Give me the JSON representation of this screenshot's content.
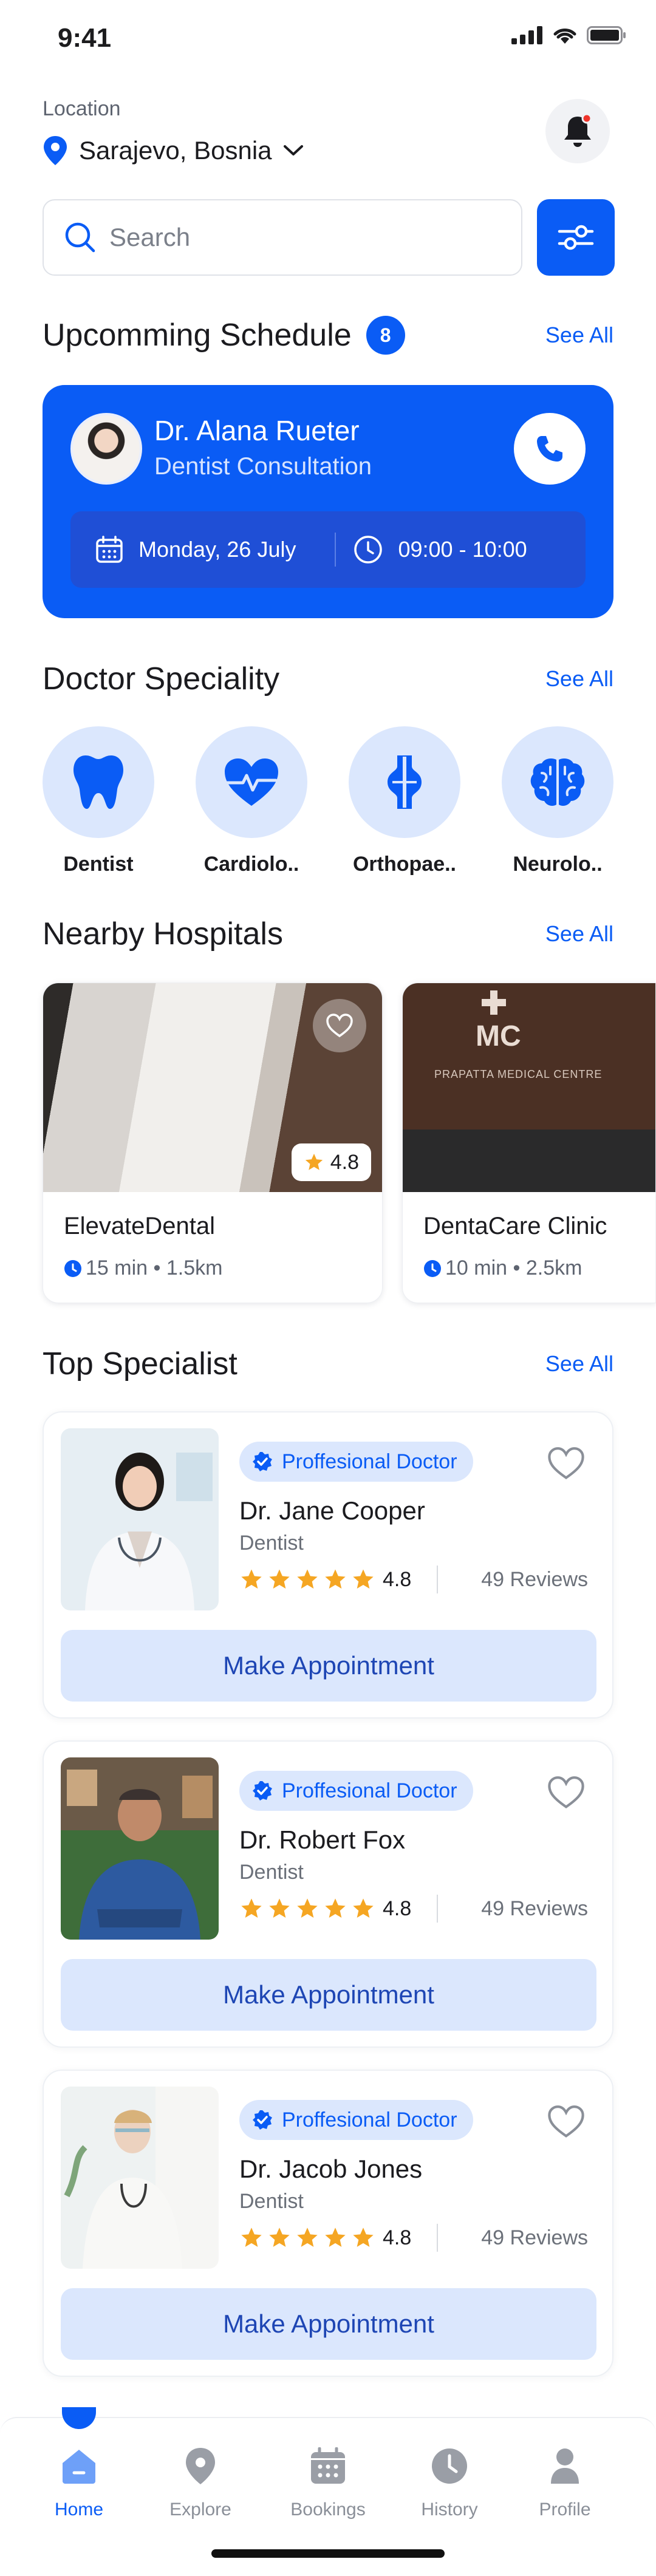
{
  "status_bar": {
    "time": "9:41"
  },
  "header": {
    "location_label": "Location",
    "location_value": "Sarajevo, Bosnia"
  },
  "search": {
    "placeholder": "Search"
  },
  "schedule": {
    "title": "Upcomming Schedule",
    "count": "8",
    "see_all": "See All",
    "doctor_name": "Dr. Alana Rueter",
    "consultation": "Dentist Consultation",
    "date": "Monday, 26 July",
    "time": "09:00 - 10:00"
  },
  "speciality": {
    "title": "Doctor Speciality",
    "see_all": "See All",
    "items": [
      {
        "label": "Dentist",
        "icon": "tooth-icon"
      },
      {
        "label": "Cardiolo..",
        "icon": "heart-pulse-icon"
      },
      {
        "label": "Orthopae..",
        "icon": "bone-joint-icon"
      },
      {
        "label": "Neurolo..",
        "icon": "brain-icon"
      }
    ]
  },
  "hospitals": {
    "title": "Nearby Hospitals",
    "see_all": "See All",
    "items": [
      {
        "name": "ElevateDental",
        "meta": "15 min • 1.5km",
        "rating": "4.8"
      },
      {
        "name": "DentaCare Clinic",
        "meta": "10 min • 2.5km",
        "sign": "MC",
        "sign_sub": "PRAPATTA MEDICAL CENTRE"
      }
    ]
  },
  "specialists": {
    "title": "Top Specialist",
    "see_all": "See All",
    "items": [
      {
        "badge": "Proffesional Doctor",
        "name": "Dr. Jane Cooper",
        "role": "Dentist",
        "rating": "4.8",
        "reviews": "49 Reviews",
        "button": "Make Appointment"
      },
      {
        "badge": "Proffesional Doctor",
        "name": "Dr. Robert Fox",
        "role": "Dentist",
        "rating": "4.8",
        "reviews": "49 Reviews",
        "button": "Make Appointment"
      },
      {
        "badge": "Proffesional Doctor",
        "name": "Dr. Jacob Jones",
        "role": "Dentist",
        "rating": "4.8",
        "reviews": "49 Reviews",
        "button": "Make Appointment"
      }
    ]
  },
  "tab_bar": {
    "items": [
      {
        "label": "Home",
        "icon": "home-icon",
        "active": true
      },
      {
        "label": "Explore",
        "icon": "map-pin-icon"
      },
      {
        "label": "Bookings",
        "icon": "calendar-icon"
      },
      {
        "label": "History",
        "icon": "clock-icon"
      },
      {
        "label": "Profile",
        "icon": "person-icon"
      }
    ]
  },
  "colors": {
    "accent": "#0a5cf5",
    "accent_light": "#dbe7fd",
    "star": "#f5a623"
  }
}
